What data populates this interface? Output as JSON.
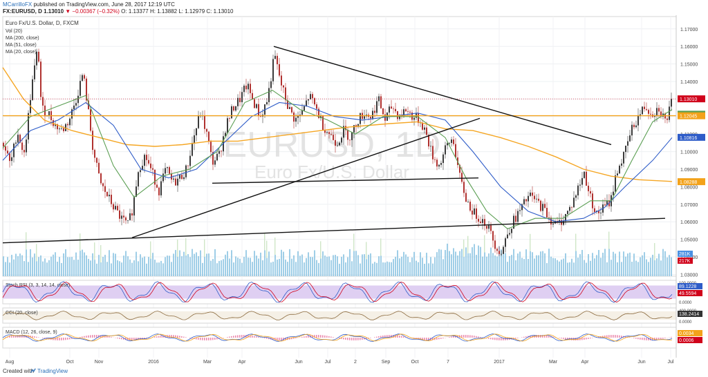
{
  "header": {
    "author": "MCarrilloFX",
    "published_text": "published on TradingView.com, June 28, 2017 12:19 UTC",
    "symbol_line": "FX:EURUSD, D",
    "price": "1.13010",
    "change": "▼ −0.00367 (−0.32%)",
    "ohlc": "O: 1.13377 H: 1.13882 L: 1.12979 C: 1.13010"
  },
  "footer": {
    "created_with": "Created with",
    "brand": "TradingView"
  },
  "chart_data": {
    "type": "line",
    "title": "Euro Fx/U.S. Dollar, D, FXCM",
    "watermark_symbol": "EURUSD, 1D",
    "watermark_name": "Euro Fx/U.S. Dollar",
    "legend": [
      "Vol (20)",
      "MA (200, close)",
      "MA (51, close)",
      "MA (20, close)"
    ],
    "colors": {
      "ma200": "#f5a623",
      "ma51": "#2e5cc8",
      "ma20": "#5a9e52",
      "up": "#3a3a3a",
      "down": "#b0312f",
      "volume": "#8ec6e3",
      "support": "#f3a21a",
      "trendline": "#111111",
      "stoch_bg": "#d7c3ef"
    },
    "x_ticks": [
      "Aug",
      "Oct",
      "Nov",
      "2016",
      "Mar",
      "Apr",
      "Jun",
      "Jul",
      "2",
      "Sep",
      "Oct",
      "7",
      "2017",
      "Mar",
      "Apr",
      "Jun",
      "Jul"
    ],
    "y_ticks": [
      "1.17000",
      "1.16000",
      "1.15000",
      "1.14000",
      "1.13000",
      "1.12000",
      "1.11000",
      "1.10000",
      "1.09000",
      "1.08000",
      "1.07000",
      "1.06000",
      "1.05000",
      "1.04000",
      "1.03000"
    ],
    "ylim": [
      1.029,
      1.177
    ],
    "price_series": [
      [
        0,
        1.105
      ],
      [
        10,
        1.092
      ],
      [
        20,
        1.112
      ],
      [
        30,
        1.098
      ],
      [
        40,
        1.135
      ],
      [
        50,
        1.16
      ],
      [
        55,
        1.124
      ],
      [
        65,
        1.122
      ],
      [
        75,
        1.115
      ],
      [
        85,
        1.112
      ],
      [
        95,
        1.118
      ],
      [
        105,
        1.13
      ],
      [
        115,
        1.145
      ],
      [
        120,
        1.131
      ],
      [
        130,
        1.1
      ],
      [
        140,
        1.082
      ],
      [
        150,
        1.075
      ],
      [
        160,
        1.068
      ],
      [
        170,
        1.062
      ],
      [
        180,
        1.058
      ],
      [
        187,
        1.068
      ],
      [
        195,
        1.09
      ],
      [
        205,
        1.098
      ],
      [
        215,
        1.088
      ],
      [
        225,
        1.078
      ],
      [
        235,
        1.09
      ],
      [
        245,
        1.082
      ],
      [
        255,
        1.085
      ],
      [
        265,
        1.09
      ],
      [
        275,
        1.108
      ],
      [
        285,
        1.122
      ],
      [
        293,
        1.112
      ],
      [
        302,
        1.094
      ],
      [
        312,
        1.098
      ],
      [
        322,
        1.115
      ],
      [
        332,
        1.125
      ],
      [
        342,
        1.13
      ],
      [
        352,
        1.138
      ],
      [
        362,
        1.128
      ],
      [
        372,
        1.12
      ],
      [
        382,
        1.13
      ],
      [
        392,
        1.155
      ],
      [
        402,
        1.138
      ],
      [
        412,
        1.125
      ],
      [
        422,
        1.118
      ],
      [
        432,
        1.122
      ],
      [
        442,
        1.132
      ],
      [
        452,
        1.125
      ],
      [
        462,
        1.115
      ],
      [
        472,
        1.11
      ],
      [
        482,
        1.105
      ],
      [
        492,
        1.112
      ],
      [
        502,
        1.108
      ],
      [
        512,
        1.118
      ],
      [
        522,
        1.122
      ],
      [
        532,
        1.12
      ],
      [
        542,
        1.13
      ],
      [
        552,
        1.118
      ],
      [
        562,
        1.126
      ],
      [
        572,
        1.12
      ],
      [
        582,
        1.124
      ],
      [
        592,
        1.12
      ],
      [
        602,
        1.118
      ],
      [
        610,
        1.112
      ],
      [
        620,
        1.098
      ],
      [
        630,
        1.092
      ],
      [
        640,
        1.102
      ],
      [
        650,
        1.108
      ],
      [
        660,
        1.085
      ],
      [
        670,
        1.072
      ],
      [
        680,
        1.065
      ],
      [
        690,
        1.062
      ],
      [
        700,
        1.058
      ],
      [
        710,
        1.048
      ],
      [
        720,
        1.042
      ],
      [
        730,
        1.055
      ],
      [
        740,
        1.062
      ],
      [
        750,
        1.068
      ],
      [
        760,
        1.075
      ],
      [
        770,
        1.072
      ],
      [
        780,
        1.068
      ],
      [
        790,
        1.062
      ],
      [
        800,
        1.058
      ],
      [
        810,
        1.062
      ],
      [
        820,
        1.068
      ],
      [
        830,
        1.078
      ],
      [
        840,
        1.088
      ],
      [
        848,
        1.075
      ],
      [
        858,
        1.064
      ],
      [
        868,
        1.068
      ],
      [
        878,
        1.072
      ],
      [
        888,
        1.09
      ],
      [
        898,
        1.098
      ],
      [
        908,
        1.112
      ],
      [
        918,
        1.12
      ],
      [
        928,
        1.126
      ],
      [
        938,
        1.122
      ],
      [
        948,
        1.125
      ],
      [
        958,
        1.117
      ],
      [
        968,
        1.13
      ]
    ],
    "ma20": [
      [
        0,
        1.102
      ],
      [
        40,
        1.12
      ],
      [
        80,
        1.126
      ],
      [
        120,
        1.132
      ],
      [
        160,
        1.092
      ],
      [
        190,
        1.074
      ],
      [
        230,
        1.086
      ],
      [
        270,
        1.09
      ],
      [
        310,
        1.1
      ],
      [
        350,
        1.128
      ],
      [
        390,
        1.135
      ],
      [
        430,
        1.124
      ],
      [
        470,
        1.118
      ],
      [
        510,
        1.11
      ],
      [
        550,
        1.12
      ],
      [
        600,
        1.12
      ],
      [
        640,
        1.108
      ],
      [
        670,
        1.085
      ],
      [
        700,
        1.066
      ],
      [
        730,
        1.056
      ],
      [
        770,
        1.062
      ],
      [
        810,
        1.062
      ],
      [
        850,
        1.072
      ],
      [
        880,
        1.072
      ],
      [
        910,
        1.095
      ],
      [
        940,
        1.117
      ],
      [
        968,
        1.124
      ]
    ],
    "ma51": [
      [
        0,
        1.095
      ],
      [
        40,
        1.112
      ],
      [
        80,
        1.118
      ],
      [
        120,
        1.128
      ],
      [
        160,
        1.115
      ],
      [
        200,
        1.09
      ],
      [
        240,
        1.085
      ],
      [
        280,
        1.09
      ],
      [
        320,
        1.105
      ],
      [
        360,
        1.12
      ],
      [
        400,
        1.128
      ],
      [
        440,
        1.126
      ],
      [
        480,
        1.12
      ],
      [
        520,
        1.118
      ],
      [
        560,
        1.12
      ],
      [
        600,
        1.122
      ],
      [
        640,
        1.118
      ],
      [
        680,
        1.1
      ],
      [
        720,
        1.08
      ],
      [
        760,
        1.066
      ],
      [
        800,
        1.06
      ],
      [
        840,
        1.062
      ],
      [
        870,
        1.068
      ],
      [
        900,
        1.08
      ],
      [
        940,
        1.095
      ],
      [
        968,
        1.108
      ]
    ],
    "ma200": [
      [
        0,
        1.148
      ],
      [
        30,
        1.13
      ],
      [
        60,
        1.118
      ],
      [
        100,
        1.112
      ],
      [
        140,
        1.108
      ],
      [
        180,
        1.104
      ],
      [
        220,
        1.103
      ],
      [
        260,
        1.104
      ],
      [
        300,
        1.106
      ],
      [
        340,
        1.106
      ],
      [
        380,
        1.108
      ],
      [
        420,
        1.11
      ],
      [
        460,
        1.112
      ],
      [
        500,
        1.114
      ],
      [
        560,
        1.116
      ],
      [
        600,
        1.117
      ],
      [
        640,
        1.113
      ],
      [
        680,
        1.112
      ],
      [
        720,
        1.108
      ],
      [
        760,
        1.103
      ],
      [
        800,
        1.097
      ],
      [
        840,
        1.09
      ],
      [
        880,
        1.086
      ],
      [
        920,
        1.084
      ],
      [
        968,
        1.083
      ]
    ],
    "support_level": 1.1205,
    "trendlines": [
      {
        "from": [
          392,
          1.16
        ],
        "to": [
          880,
          1.104
        ]
      },
      {
        "from": [
          187,
          1.051
        ],
        "to": [
          690,
          1.119
        ]
      },
      {
        "from": [
          303,
          1.082
        ],
        "to": [
          688,
          1.085
        ]
      },
      {
        "from": [
          0,
          1.048
        ],
        "to": [
          958,
          1.062
        ]
      }
    ],
    "price_labels": [
      {
        "text": "1.13010",
        "value": 1.1301,
        "color": "#d0021b"
      },
      {
        "text": "1.12134",
        "value": 1.12134,
        "color": "#5a9e52"
      },
      {
        "text": "1.12045",
        "value": 1.12045,
        "color": "#f3a21a"
      },
      {
        "text": "1.10816",
        "value": 1.10816,
        "color": "#2e5cc8"
      },
      {
        "text": "1.08288",
        "value": 1.08288,
        "color": "#f3a21a"
      }
    ],
    "volume_labels": [
      {
        "text": "281K",
        "color": "#4a90e2"
      },
      {
        "text": "217K",
        "color": "#d0021b"
      }
    ],
    "stoch": {
      "title": "Stoch RSI (3, 3, 14, 14, close)",
      "y_ticks": [
        "100.0000",
        "0.0000"
      ],
      "labels": [
        {
          "text": "89.1228",
          "color": "#2e5cc8"
        },
        {
          "text": "49.5594",
          "color": "#d0021b"
        }
      ]
    },
    "cci": {
      "title": "CCI (20, close)",
      "y_ticks": [
        "400.0000",
        "0.0000"
      ],
      "labels": [
        {
          "text": "138.2414",
          "color": "#333333"
        }
      ]
    },
    "macd": {
      "title": "MACD (12, 26, close, 9)",
      "labels": [
        {
          "text": "0.0034",
          "color": "#f3a21a"
        },
        {
          "text": "0.0006",
          "color": "#d0021b"
        }
      ]
    }
  }
}
